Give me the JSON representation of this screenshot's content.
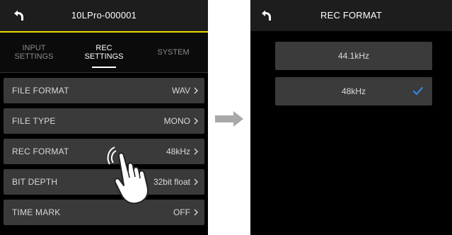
{
  "left": {
    "title": "10LPro-000001",
    "tabs": [
      {
        "label": "INPUT\nSETTINGS",
        "active": false
      },
      {
        "label": "REC\nSETTINGS",
        "active": true
      },
      {
        "label": "SYSTEM",
        "active": false
      }
    ],
    "items": [
      {
        "label": "FILE FORMAT",
        "value": "WAV"
      },
      {
        "label": "FILE TYPE",
        "value": "MONO"
      },
      {
        "label": "REC FORMAT",
        "value": "48kHz"
      },
      {
        "label": "BIT DEPTH",
        "value": "32bit float"
      },
      {
        "label": "TIME MARK",
        "value": "OFF"
      }
    ]
  },
  "right": {
    "title": "REC FORMAT",
    "options": [
      {
        "label": "44.1kHz",
        "selected": false
      },
      {
        "label": "48kHz",
        "selected": true
      }
    ]
  },
  "icons": {
    "back": "back-arrow-icon",
    "chevron": "chevron-right-icon",
    "check": "checkmark-icon",
    "transition": "arrow-right-icon",
    "tap": "tapping-hand-icon"
  },
  "colors": {
    "accent_underline": "#e8d900",
    "checkmark": "#2e8ff0",
    "row_bg": "#3a3a3a",
    "screen_bg": "#000000"
  }
}
